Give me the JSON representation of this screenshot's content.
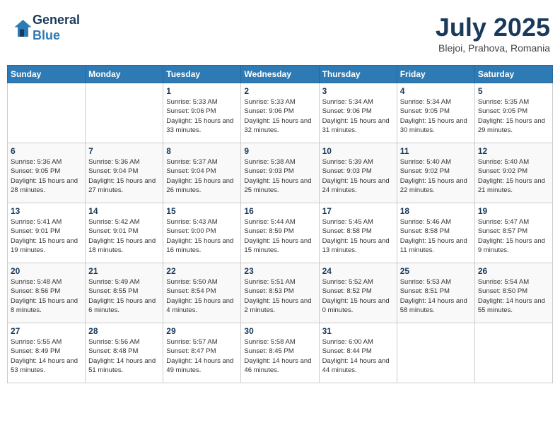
{
  "header": {
    "logo_line1": "General",
    "logo_line2": "Blue",
    "month": "July 2025",
    "location": "Blejoi, Prahova, Romania"
  },
  "weekdays": [
    "Sunday",
    "Monday",
    "Tuesday",
    "Wednesday",
    "Thursday",
    "Friday",
    "Saturday"
  ],
  "weeks": [
    [
      {
        "day": "",
        "sunrise": "",
        "sunset": "",
        "daylight": ""
      },
      {
        "day": "",
        "sunrise": "",
        "sunset": "",
        "daylight": ""
      },
      {
        "day": "1",
        "sunrise": "Sunrise: 5:33 AM",
        "sunset": "Sunset: 9:06 PM",
        "daylight": "Daylight: 15 hours and 33 minutes."
      },
      {
        "day": "2",
        "sunrise": "Sunrise: 5:33 AM",
        "sunset": "Sunset: 9:06 PM",
        "daylight": "Daylight: 15 hours and 32 minutes."
      },
      {
        "day": "3",
        "sunrise": "Sunrise: 5:34 AM",
        "sunset": "Sunset: 9:06 PM",
        "daylight": "Daylight: 15 hours and 31 minutes."
      },
      {
        "day": "4",
        "sunrise": "Sunrise: 5:34 AM",
        "sunset": "Sunset: 9:05 PM",
        "daylight": "Daylight: 15 hours and 30 minutes."
      },
      {
        "day": "5",
        "sunrise": "Sunrise: 5:35 AM",
        "sunset": "Sunset: 9:05 PM",
        "daylight": "Daylight: 15 hours and 29 minutes."
      }
    ],
    [
      {
        "day": "6",
        "sunrise": "Sunrise: 5:36 AM",
        "sunset": "Sunset: 9:05 PM",
        "daylight": "Daylight: 15 hours and 28 minutes."
      },
      {
        "day": "7",
        "sunrise": "Sunrise: 5:36 AM",
        "sunset": "Sunset: 9:04 PM",
        "daylight": "Daylight: 15 hours and 27 minutes."
      },
      {
        "day": "8",
        "sunrise": "Sunrise: 5:37 AM",
        "sunset": "Sunset: 9:04 PM",
        "daylight": "Daylight: 15 hours and 26 minutes."
      },
      {
        "day": "9",
        "sunrise": "Sunrise: 5:38 AM",
        "sunset": "Sunset: 9:03 PM",
        "daylight": "Daylight: 15 hours and 25 minutes."
      },
      {
        "day": "10",
        "sunrise": "Sunrise: 5:39 AM",
        "sunset": "Sunset: 9:03 PM",
        "daylight": "Daylight: 15 hours and 24 minutes."
      },
      {
        "day": "11",
        "sunrise": "Sunrise: 5:40 AM",
        "sunset": "Sunset: 9:02 PM",
        "daylight": "Daylight: 15 hours and 22 minutes."
      },
      {
        "day": "12",
        "sunrise": "Sunrise: 5:40 AM",
        "sunset": "Sunset: 9:02 PM",
        "daylight": "Daylight: 15 hours and 21 minutes."
      }
    ],
    [
      {
        "day": "13",
        "sunrise": "Sunrise: 5:41 AM",
        "sunset": "Sunset: 9:01 PM",
        "daylight": "Daylight: 15 hours and 19 minutes."
      },
      {
        "day": "14",
        "sunrise": "Sunrise: 5:42 AM",
        "sunset": "Sunset: 9:01 PM",
        "daylight": "Daylight: 15 hours and 18 minutes."
      },
      {
        "day": "15",
        "sunrise": "Sunrise: 5:43 AM",
        "sunset": "Sunset: 9:00 PM",
        "daylight": "Daylight: 15 hours and 16 minutes."
      },
      {
        "day": "16",
        "sunrise": "Sunrise: 5:44 AM",
        "sunset": "Sunset: 8:59 PM",
        "daylight": "Daylight: 15 hours and 15 minutes."
      },
      {
        "day": "17",
        "sunrise": "Sunrise: 5:45 AM",
        "sunset": "Sunset: 8:58 PM",
        "daylight": "Daylight: 15 hours and 13 minutes."
      },
      {
        "day": "18",
        "sunrise": "Sunrise: 5:46 AM",
        "sunset": "Sunset: 8:58 PM",
        "daylight": "Daylight: 15 hours and 11 minutes."
      },
      {
        "day": "19",
        "sunrise": "Sunrise: 5:47 AM",
        "sunset": "Sunset: 8:57 PM",
        "daylight": "Daylight: 15 hours and 9 minutes."
      }
    ],
    [
      {
        "day": "20",
        "sunrise": "Sunrise: 5:48 AM",
        "sunset": "Sunset: 8:56 PM",
        "daylight": "Daylight: 15 hours and 8 minutes."
      },
      {
        "day": "21",
        "sunrise": "Sunrise: 5:49 AM",
        "sunset": "Sunset: 8:55 PM",
        "daylight": "Daylight: 15 hours and 6 minutes."
      },
      {
        "day": "22",
        "sunrise": "Sunrise: 5:50 AM",
        "sunset": "Sunset: 8:54 PM",
        "daylight": "Daylight: 15 hours and 4 minutes."
      },
      {
        "day": "23",
        "sunrise": "Sunrise: 5:51 AM",
        "sunset": "Sunset: 8:53 PM",
        "daylight": "Daylight: 15 hours and 2 minutes."
      },
      {
        "day": "24",
        "sunrise": "Sunrise: 5:52 AM",
        "sunset": "Sunset: 8:52 PM",
        "daylight": "Daylight: 15 hours and 0 minutes."
      },
      {
        "day": "25",
        "sunrise": "Sunrise: 5:53 AM",
        "sunset": "Sunset: 8:51 PM",
        "daylight": "Daylight: 14 hours and 58 minutes."
      },
      {
        "day": "26",
        "sunrise": "Sunrise: 5:54 AM",
        "sunset": "Sunset: 8:50 PM",
        "daylight": "Daylight: 14 hours and 55 minutes."
      }
    ],
    [
      {
        "day": "27",
        "sunrise": "Sunrise: 5:55 AM",
        "sunset": "Sunset: 8:49 PM",
        "daylight": "Daylight: 14 hours and 53 minutes."
      },
      {
        "day": "28",
        "sunrise": "Sunrise: 5:56 AM",
        "sunset": "Sunset: 8:48 PM",
        "daylight": "Daylight: 14 hours and 51 minutes."
      },
      {
        "day": "29",
        "sunrise": "Sunrise: 5:57 AM",
        "sunset": "Sunset: 8:47 PM",
        "daylight": "Daylight: 14 hours and 49 minutes."
      },
      {
        "day": "30",
        "sunrise": "Sunrise: 5:58 AM",
        "sunset": "Sunset: 8:45 PM",
        "daylight": "Daylight: 14 hours and 46 minutes."
      },
      {
        "day": "31",
        "sunrise": "Sunrise: 6:00 AM",
        "sunset": "Sunset: 8:44 PM",
        "daylight": "Daylight: 14 hours and 44 minutes."
      },
      {
        "day": "",
        "sunrise": "",
        "sunset": "",
        "daylight": ""
      },
      {
        "day": "",
        "sunrise": "",
        "sunset": "",
        "daylight": ""
      }
    ]
  ]
}
